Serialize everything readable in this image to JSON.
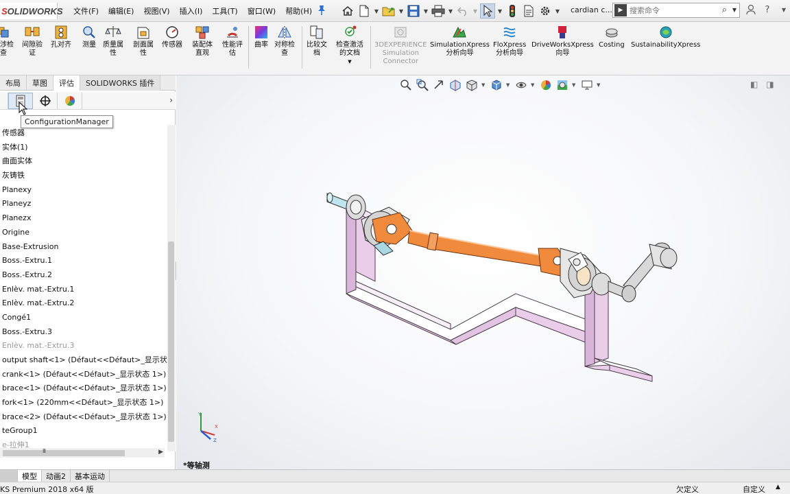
{
  "app": {
    "logo_prefix": "S",
    "logo_main": "OLIDWORKS",
    "menus": [
      "文件(F)",
      "编辑(E)",
      "视图(V)",
      "插入(I)",
      "工具(T)",
      "窗口(W)",
      "帮助(H)"
    ],
    "document_title": "cardian c...",
    "search_placeholder": "搜索命令"
  },
  "command_manager": {
    "tools": [
      {
        "label": "干涉检\n查",
        "icon": "interference-check-icon"
      },
      {
        "label": "间隙验\n证",
        "icon": "clearance-verification-icon"
      },
      {
        "label": "孔对齐",
        "icon": "hole-alignment-icon"
      },
      {
        "label": "测量",
        "icon": "measure-icon"
      },
      {
        "label": "质量属\n性",
        "icon": "mass-properties-icon"
      },
      {
        "label": "剖面属\n性",
        "icon": "section-properties-icon"
      },
      {
        "label": "传感器",
        "icon": "sensor-icon"
      },
      {
        "label": "装配体\n直观",
        "icon": "assembly-visualization-icon"
      },
      {
        "label": "性能评\n估",
        "icon": "performance-evaluation-icon"
      },
      {
        "label": "曲率",
        "icon": "curvature-icon"
      },
      {
        "label": "对称检\n查",
        "icon": "symmetry-check-icon"
      },
      {
        "label": "比较文\n档",
        "icon": "compare-documents-icon"
      },
      {
        "label": "检查激活\n的文档",
        "icon": "check-active-document-icon"
      },
      {
        "label": "3DEXPERIENCE\nSimulation\nConnector",
        "icon": "simulation-connector-icon",
        "disabled": true
      },
      {
        "label": "SimulationXpress\n分析向导",
        "icon": "simulationxpress-icon"
      },
      {
        "label": "FloXpress\n分析向导",
        "icon": "floxpress-icon"
      },
      {
        "label": "DriveWorksXpress\n向导",
        "icon": "driveworksxpress-icon"
      },
      {
        "label": "Costing",
        "icon": "costing-icon"
      },
      {
        "label": "SustainabilityXpress",
        "icon": "sustainabilityxpress-icon"
      }
    ]
  },
  "panel": {
    "tabs": [
      "布局",
      "草图",
      "评估",
      "SOLIDWORKS 插件"
    ],
    "active_tab": "评估",
    "tooltip": "ConfigurationManager",
    "tree": [
      "传感器",
      "实体(1)",
      "曲面实体",
      "灰铸铁",
      "Planexy",
      "Planeyz",
      "Planezx",
      "Origine",
      "Base-Extrusion",
      "Boss.-Extru.1",
      "Boss.-Extru.2",
      "Enlèv. mat.-Extru.1",
      "Enlèv. mat.-Extru.2",
      "Congé1",
      "Boss.-Extru.3",
      "Enlèv. mat.-Extru.3",
      "output shaft<1> (Défaut<<Défaut>_显示状态",
      "crank<1> (Défaut<<Défaut>_显示状态 1>)",
      "brace<1> (Défaut<<Défaut>_显示状态 1>)",
      "fork<1> (220mm<<Défaut>_显示状态 1>)",
      "brace<2> (Défaut<<Défaut>_显示状态 1>)",
      "teGroup1",
      "e-拉伸1"
    ],
    "grey_items": [
      "Enlèv. mat.-Extru.3",
      "e-拉伸1"
    ]
  },
  "viewport": {
    "view_name": "*等轴测",
    "colors": {
      "frame": "#e9cde9",
      "frame_edge": "#5a4a5a",
      "shaft": "#f08a3c",
      "metal": "#d8d8d8"
    }
  },
  "bottom_tabs": [
    "模型",
    "动画2",
    "基本运动"
  ],
  "statusbar": {
    "left": "KS Premium 2018 x64 版",
    "definition": "欠定义",
    "custom": "自定义"
  }
}
